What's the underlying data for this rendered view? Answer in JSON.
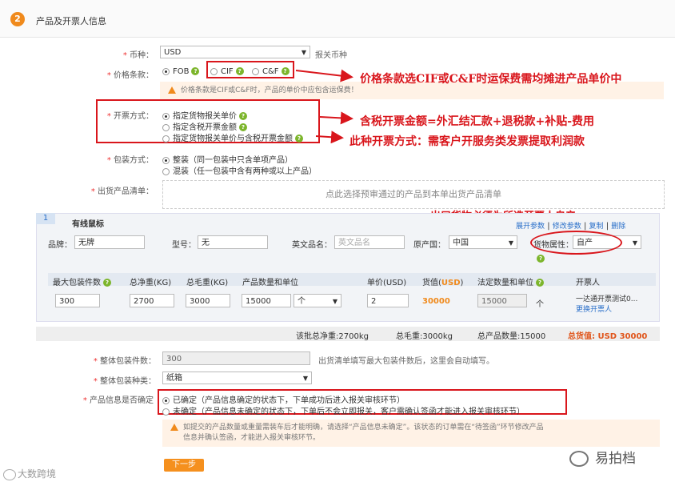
{
  "section": {
    "step": "2",
    "title": "产品及开票人信息"
  },
  "currency": {
    "label": "币种：",
    "value": "USD",
    "note": "报关币种"
  },
  "price_terms": {
    "label": "价格条款：",
    "options": [
      "FOB",
      "CIF",
      "C&F"
    ],
    "selected": "FOB",
    "warning": "价格条款是CIF或C&F时，产品的单价中应包含运保费！"
  },
  "invoice_method": {
    "label": "开票方式：",
    "options": [
      "指定货物报关单价",
      "指定含税开票金额",
      "指定货物报关单价与含税开票金额"
    ],
    "selected": 0
  },
  "packing_method": {
    "label": "包装方式：",
    "options": [
      "整装（同一包装中只含单项产品）",
      "混装（任一包装中含有两种或以上产品）"
    ],
    "selected": 0
  },
  "export_list": {
    "label": "出货产品清单：",
    "placeholder": "点此选择预审通过的产品到本单出货产品清单"
  },
  "annotations": {
    "a1": "价格条款选CIF或C&F时运保费需均摊进产品单价中",
    "a2": "含税开票金额=外汇结汇款+退税款+补贴-费用",
    "a3": "此种开票方式：需客户开服务类发票提取利润款",
    "a4": "出口货物必须为所选开票人自产"
  },
  "product": {
    "index": "1",
    "name": "有线鼠标",
    "actions": [
      "展开参数",
      "修改参数",
      "复制",
      "删除"
    ],
    "brand_label": "品牌：",
    "brand_value": "无牌",
    "model_label": "型号：",
    "model_value": "无",
    "en_name_label": "英文品名：",
    "en_name_placeholder": "英文品名",
    "origin_label": "原产国：",
    "origin_value": "中国",
    "goods_attr_label": "货物属性：",
    "goods_attr_value": "自产",
    "columns": [
      "最大包装件数",
      "总净重(KG)",
      "总毛重(KG)",
      "产品数量和单位",
      "单价(USD)",
      "货值(USD)",
      "法定数量和单位",
      "开票人"
    ],
    "row": {
      "max_pkg": "300",
      "net_weight": "2700",
      "gross_weight": "3000",
      "qty": "15000",
      "unit": "个",
      "unit_price": "2",
      "value": "30000",
      "legal_qty": "15000",
      "legal_unit": "个",
      "invoicer": "一达通开票测试0...",
      "change_invoicer": "更换开票人"
    }
  },
  "summary": {
    "net": "该批总净重:2700kg",
    "gross": "总毛重:3000kg",
    "qty": "总产品数量:15000",
    "total_label": "总货值:",
    "total_value": "USD 30000"
  },
  "total_packages": {
    "label": "整体包装件数：",
    "value": "300",
    "note": "出货清单填写最大包装件数后，这里会自动填写。"
  },
  "package_type": {
    "label": "整体包装种类：",
    "value": "纸箱"
  },
  "product_info": {
    "label": "产品信息是否确定",
    "options": [
      "已确定（产品信息确定的状态下，下单成功后进入报关审核环节）",
      "未确定（产品信息未确定的状态下，下单后不会立即报关，客户需确认签函才能进入报关审核环节）"
    ],
    "selected": 0,
    "warning_line1": "如提交的产品数量或重量需装车后才能明确，请选择“产品信息未确定”。该状态的订单需在“待签函”环节修改产品",
    "warning_line2": "信息并确认签函，才能进入报关审核环节。"
  },
  "next_button": "下一步",
  "watermarks": {
    "left": "大数跨境",
    "right": "易拍档"
  },
  "colors": {
    "accent": "#f08a1c",
    "annotation": "#d9161c",
    "link": "#2a6fc9",
    "help": "#7cb52b"
  }
}
